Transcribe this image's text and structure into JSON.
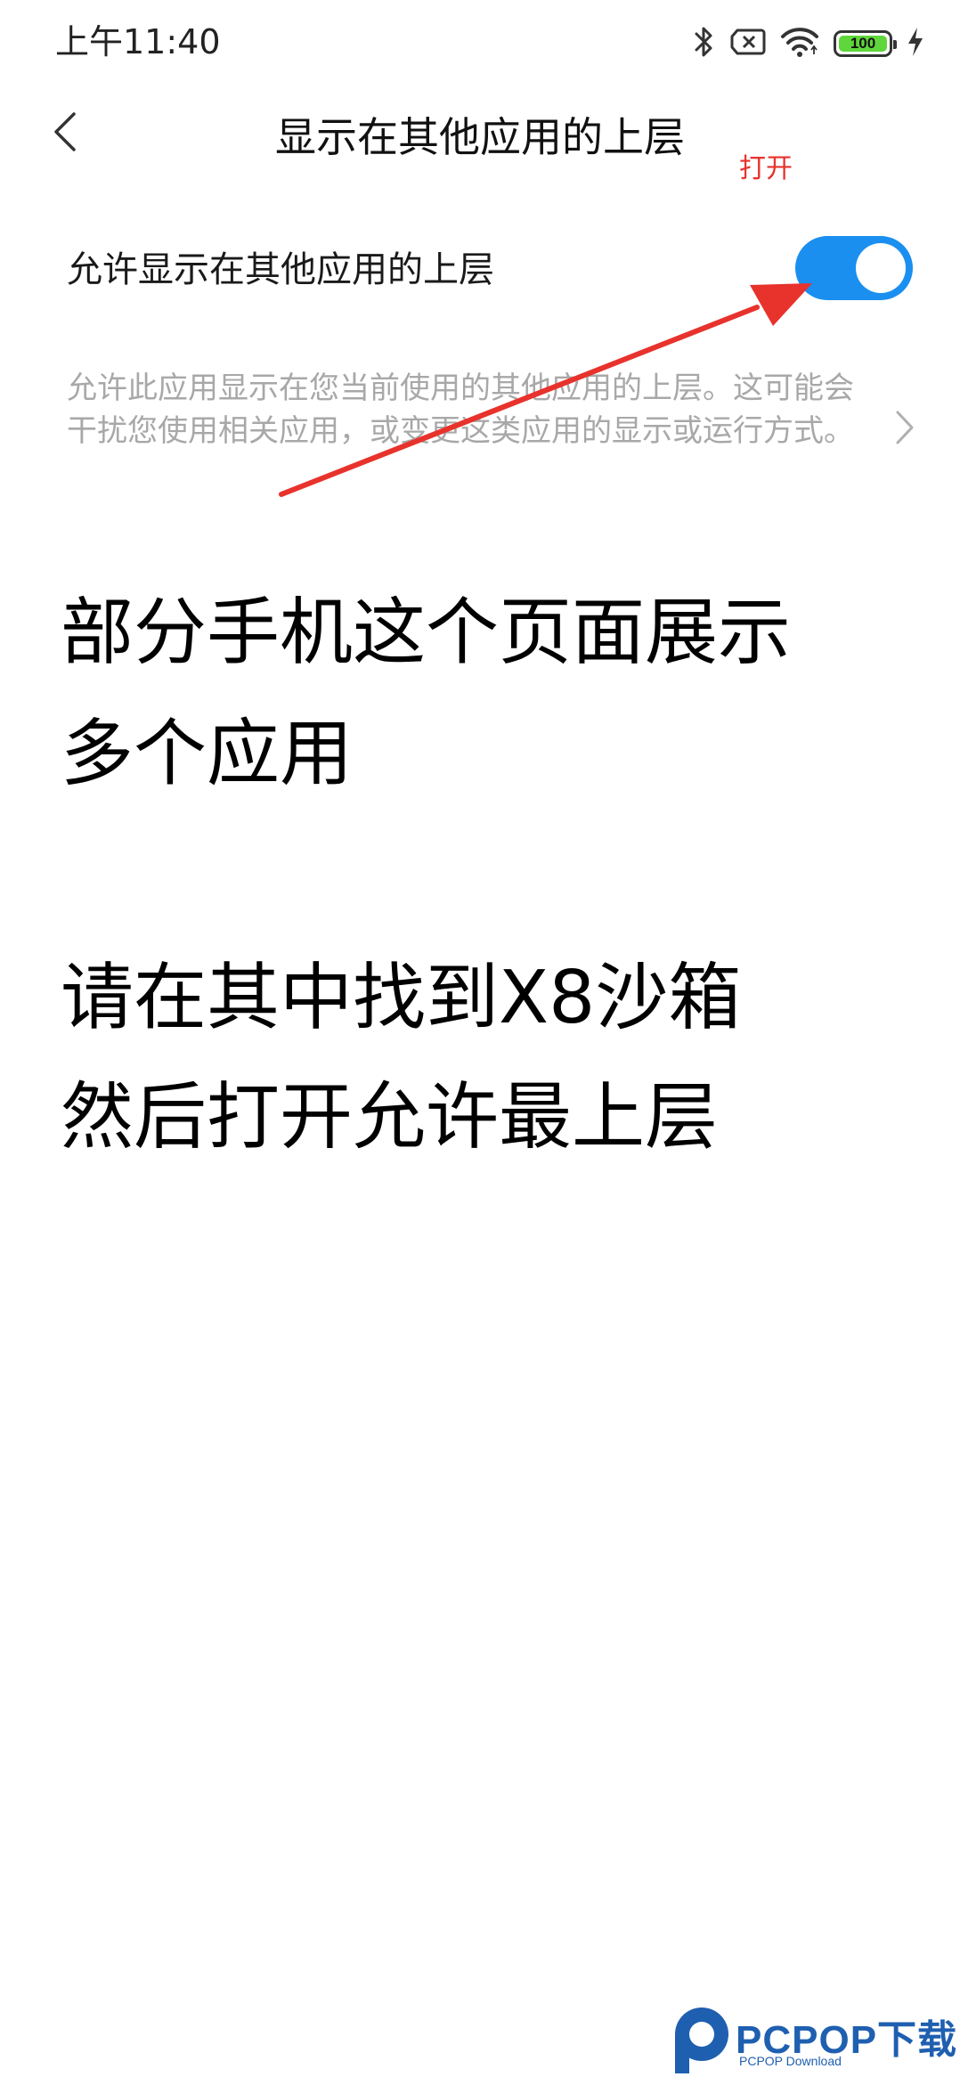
{
  "status_bar": {
    "time": "上午11:40",
    "battery_level": "100",
    "battery_fraction": 1.0,
    "icons": [
      "bluetooth-icon",
      "sim-off-icon",
      "wifi-icon",
      "battery-icon",
      "charging-icon"
    ]
  },
  "header": {
    "back_icon": "chevron-left-icon",
    "title": "显示在其他应用的上层"
  },
  "annotation": {
    "label": "打开",
    "color": "#e8322c"
  },
  "setting": {
    "label": "允许显示在其他应用的上层",
    "toggle_on": true,
    "toggle_color": "#1a8ff0"
  },
  "description": {
    "text": "允许此应用显示在您当前使用的其他应用的上层。这可能会干扰您使用相关应用，或变更这类应用的显示或运行方式。",
    "chevron_icon": "chevron-right-icon"
  },
  "instructions": {
    "line1": "部分手机这个页面展示",
    "line2": "多个应用",
    "line3": "请在其中找到X8沙箱",
    "line4": "然后打开允许最上层"
  },
  "watermark": {
    "brand": "PCPOP下载",
    "sub": "PCPOP Download"
  }
}
